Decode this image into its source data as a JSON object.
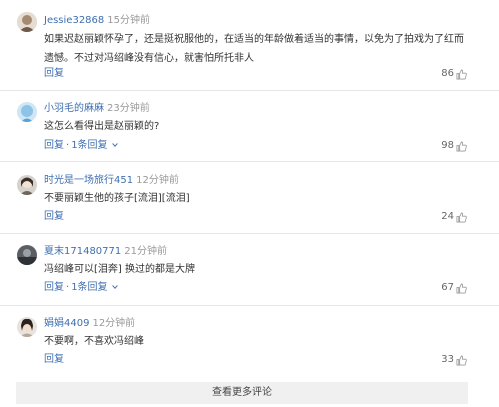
{
  "comments": [
    {
      "username": "Jessie32868",
      "time": "15分钟前",
      "text": "如果迟赵丽颖怀孕了，还是挺祝服他的，在适当的年龄做着适当的事情，以免为了拍戏为了红而遗憾。不过对冯绍峰没有信心，就害怕所托非人",
      "reply": "回复",
      "reply_count": "",
      "likes": "86"
    },
    {
      "username": "小羽毛的麻麻",
      "time": "23分钟前",
      "text": "这怎么看得出是赵丽颖的?",
      "reply": "回复",
      "reply_count": "1条回复",
      "likes": "98"
    },
    {
      "username": "时光是一场旅行451",
      "time": "12分钟前",
      "text": "不要丽颖生他的孩子[流泪][流泪]",
      "reply": "回复",
      "reply_count": "",
      "likes": "24"
    },
    {
      "username": "夏末171480771",
      "time": "21分钟前",
      "text": "冯绍峰可以[泪奔] 换过的都是大牌",
      "reply": "回复",
      "reply_count": "1条回复",
      "likes": "67"
    },
    {
      "username": "娟娟4409",
      "time": "12分钟前",
      "text": "不要啊，不喜欢冯绍峰",
      "reply": "回复",
      "reply_count": "",
      "likes": "33"
    }
  ],
  "more_label": "查看更多评论",
  "colors": {
    "link": "#3f6fb0",
    "muted": "#999999",
    "bar": "#f0f0f0"
  },
  "icons": {
    "like": "thumbs-up-icon",
    "reply_expand": "comment-bubble-icon"
  }
}
